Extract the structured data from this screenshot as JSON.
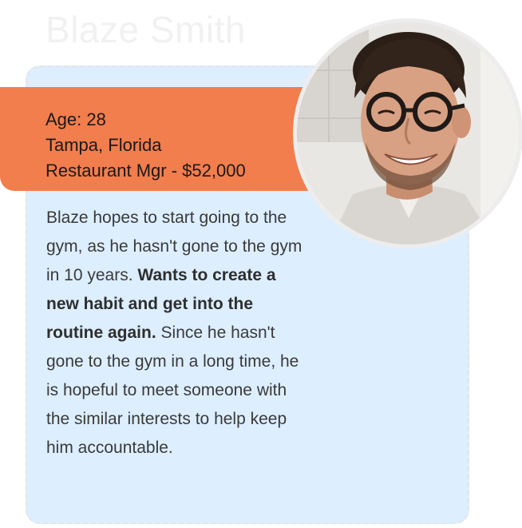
{
  "persona": {
    "name": "Blaze Smith",
    "age": "Age: 28",
    "location": "Tampa, Florida",
    "occupation": "Restaurant Mgr - $52,000",
    "bio": {
      "intro": "Blaze hopes to start going to the gym, as he hasn't gone to the gym in 10 years.",
      "highlight": "Wants to create a new habit and get into the routine again.",
      "outro": "Since he hasn't gone to the gym in a long time, he is hopeful to meet someone with the similar interests to help keep him accountable."
    }
  },
  "colors": {
    "banner": "#f27d4d",
    "card": "#ddeeff",
    "name": "#f1f1f1"
  }
}
